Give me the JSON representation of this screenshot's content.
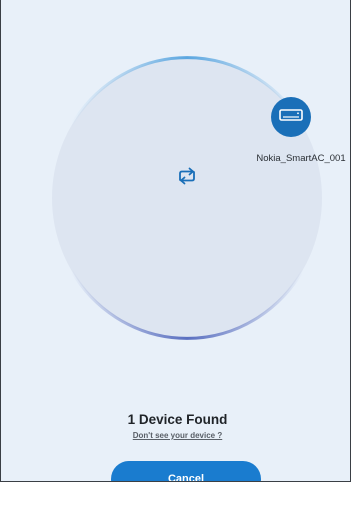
{
  "scan": {
    "icon": "scan-refresh-icon"
  },
  "devices": [
    {
      "name": "Nokia_SmartAC_001",
      "icon": "air-conditioner-icon"
    }
  ],
  "status": {
    "title": "1 Device Found",
    "help_link": "Don't see your device ?"
  },
  "actions": {
    "cancel_label": "Cancel"
  },
  "colors": {
    "background": "#e8f0f9",
    "radar_fill": "#dde5f1",
    "accent": "#1a7ccf",
    "device_badge": "#1a6fb8"
  }
}
